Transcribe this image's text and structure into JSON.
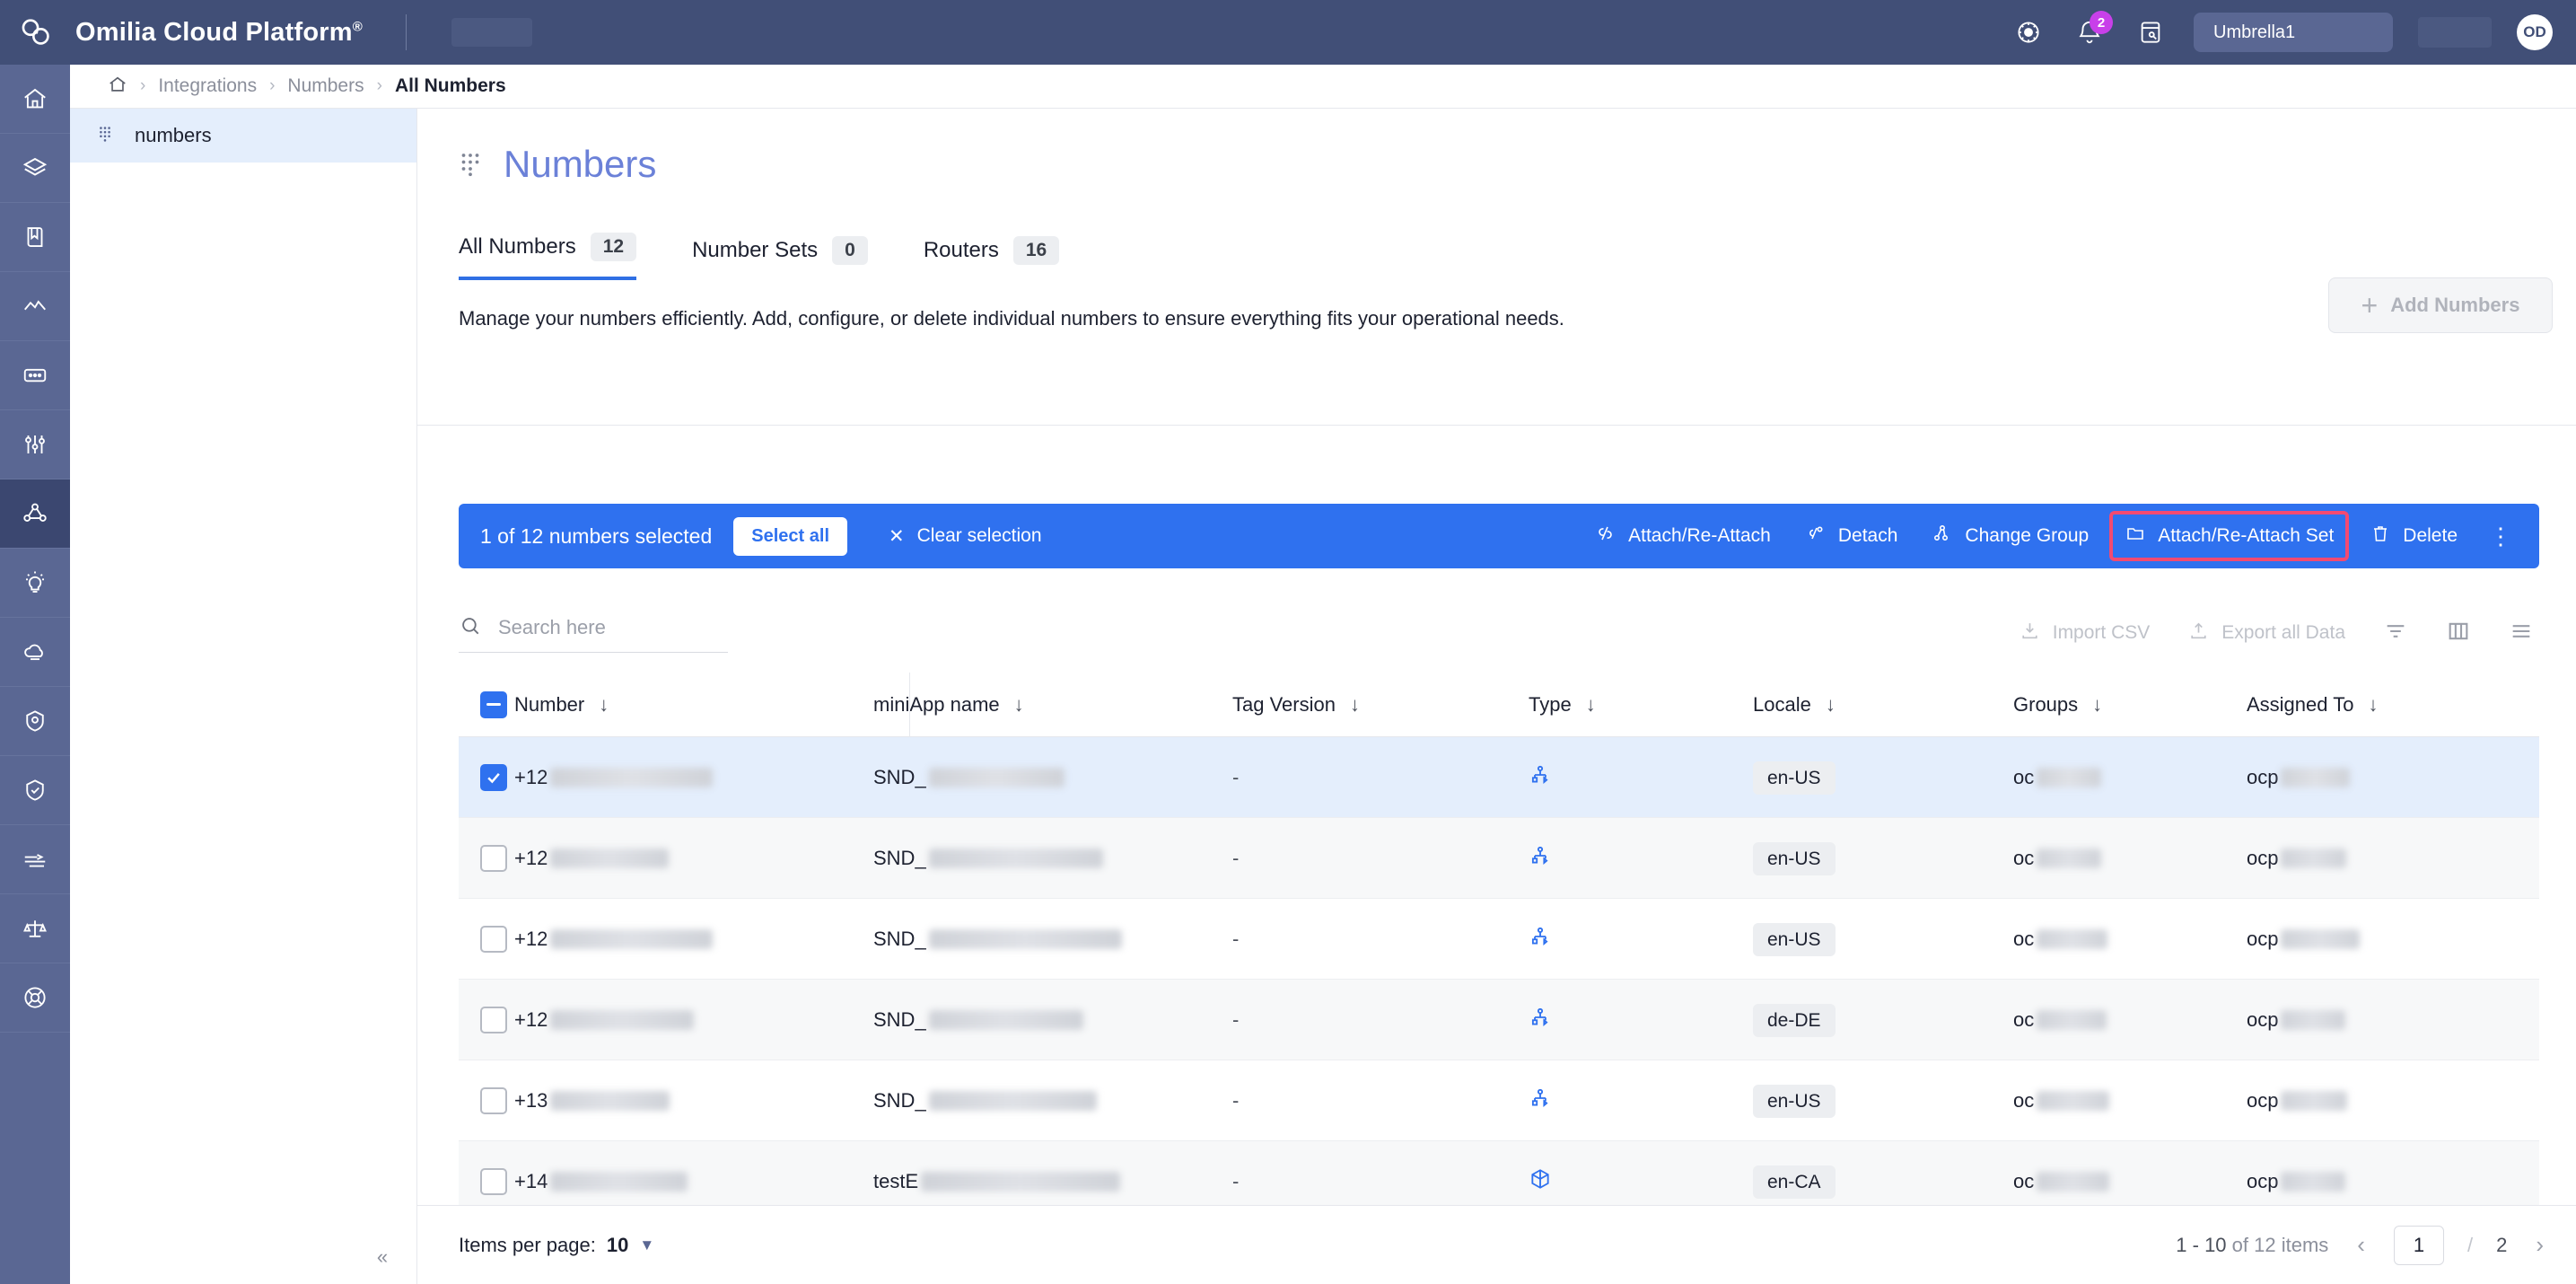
{
  "header": {
    "brand_title": "Omilia Cloud Platform",
    "brand_reg": "®",
    "notification_count": "2",
    "tenant": "Umbrella1",
    "avatar_initials": "OD",
    "icons": [
      "theme-icon",
      "bell-icon",
      "note-edit-icon"
    ]
  },
  "breadcrumb": {
    "home": "home-icon",
    "items": [
      "Integrations",
      "Numbers"
    ],
    "current": "All Numbers",
    "separator": "›"
  },
  "left_panel": {
    "item_label": "numbers",
    "collapse_label": "«"
  },
  "rail": {
    "items": [
      {
        "name": "home-icon"
      },
      {
        "name": "layers-icon"
      },
      {
        "name": "book-icon"
      },
      {
        "name": "analytics-icon"
      },
      {
        "name": "dialog-icon"
      },
      {
        "name": "sliders-icon"
      },
      {
        "name": "integrations-icon",
        "active": true
      },
      {
        "name": "lightbulb-icon"
      },
      {
        "name": "cloud-icon"
      },
      {
        "name": "settings-user-icon"
      },
      {
        "name": "badge-check-icon"
      },
      {
        "name": "stack-lines-icon"
      },
      {
        "name": "scales-icon"
      },
      {
        "name": "lifebuoy-icon"
      }
    ]
  },
  "page": {
    "title": "Numbers",
    "subtitle": "Manage your numbers efficiently. Add, configure, or delete individual numbers to ensure everything fits your operational needs.",
    "add_button": "Add Numbers",
    "add_plus": "+"
  },
  "tabs": [
    {
      "label": "All Numbers",
      "count": "12",
      "active": true
    },
    {
      "label": "Number Sets",
      "count": "0",
      "active": false
    },
    {
      "label": "Routers",
      "count": "16",
      "active": false
    }
  ],
  "selection_bar": {
    "status": "1 of 12 numbers selected",
    "select_all": "Select all",
    "clear_selection": "Clear selection",
    "clear_icon": "✕",
    "actions": [
      {
        "label": "Attach/Re-Attach",
        "icon": "attach-icon",
        "highlight": false
      },
      {
        "label": "Detach",
        "icon": "detach-icon",
        "highlight": false
      },
      {
        "label": "Change Group",
        "icon": "group-icon",
        "highlight": false
      },
      {
        "label": "Attach/Re-Attach Set",
        "icon": "folder-icon",
        "highlight": true
      },
      {
        "label": "Delete",
        "icon": "trash-icon",
        "highlight": false
      }
    ],
    "more_icon": "⋮",
    "bg_color": "#2f71ef",
    "highlight_color": "#f24a72"
  },
  "table_toolbar": {
    "search_placeholder": "Search here",
    "search_value": "",
    "import_csv": "Import CSV",
    "export_all": "Export all Data",
    "icons": [
      "filter-icon",
      "columns-icon",
      "density-icon"
    ]
  },
  "table": {
    "columns": [
      "Number",
      "miniApp name",
      "Tag Version",
      "Type",
      "Locale",
      "Groups",
      "Assigned To"
    ],
    "header_checkbox_state": "indeterminate",
    "sort_icon": "↓",
    "rows": [
      {
        "checked": true,
        "number": "+12",
        "miniapp": "SND_",
        "tag": "-",
        "type": "router-icon",
        "locale": "en-US",
        "group": "oc",
        "assigned": "ocp"
      },
      {
        "checked": false,
        "number": "+12",
        "miniapp": "SND_",
        "tag": "-",
        "type": "router-icon",
        "locale": "en-US",
        "group": "oc",
        "assigned": "ocp"
      },
      {
        "checked": false,
        "number": "+12",
        "miniapp": "SND_",
        "tag": "-",
        "type": "router-icon",
        "locale": "en-US",
        "group": "oc",
        "assigned": "ocp"
      },
      {
        "checked": false,
        "number": "+12",
        "miniapp": "SND_",
        "tag": "-",
        "type": "router-icon",
        "locale": "de-DE",
        "group": "oc",
        "assigned": "ocp"
      },
      {
        "checked": false,
        "number": "+13",
        "miniapp": "SND_",
        "tag": "-",
        "type": "router-icon",
        "locale": "en-US",
        "group": "oc",
        "assigned": "ocp"
      },
      {
        "checked": false,
        "number": "+14",
        "miniapp": "testE",
        "tag": "-",
        "type": "cube-icon",
        "locale": "en-CA",
        "group": "oc",
        "assigned": "ocp"
      }
    ]
  },
  "footer": {
    "items_per_page_label": "Items per page:",
    "items_per_page_value": "10",
    "range": "1 - 10",
    "range_suffix": "of 12 items",
    "current_page": "1",
    "page_slash": "/",
    "total_pages": "2",
    "prev_icon": "‹",
    "next_icon": "›"
  }
}
